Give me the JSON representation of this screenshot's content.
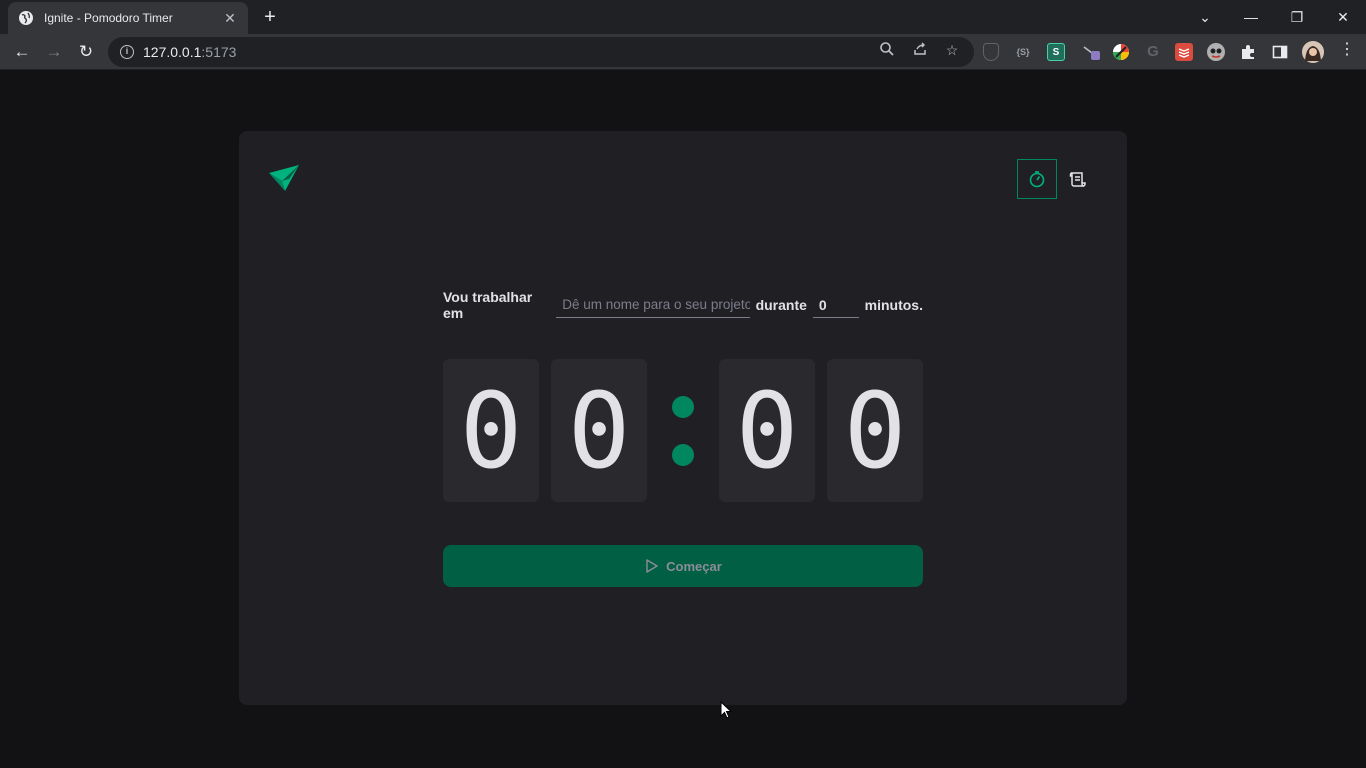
{
  "browser": {
    "tab_title": "Ignite - Pomodoro Timer",
    "url_host": "127.0.0.1",
    "url_port": ":5173",
    "extensions": [
      {
        "name": "shield-extension-icon",
        "label": "",
        "color": "#5f6368"
      },
      {
        "name": "s-bracket-extension-icon",
        "label": "{S}",
        "color": "#35363a"
      },
      {
        "name": "s-extension-icon",
        "label": "S",
        "color": "#0f9d58"
      },
      {
        "name": "arrow-extension-icon",
        "label": "",
        "color": "#8e7cc3"
      },
      {
        "name": "color-wheel-extension-icon",
        "label": "",
        "color": "#34a853"
      },
      {
        "name": "g-extension-icon",
        "label": "",
        "color": "#5f6368"
      },
      {
        "name": "todoist-extension-icon",
        "label": "",
        "color": "#db4c3f"
      },
      {
        "name": "mask-extension-icon",
        "label": "",
        "color": "#9e9e9e"
      }
    ]
  },
  "app": {
    "accent": "#00875f",
    "form": {
      "label_before": "Vou trabalhar em",
      "task_placeholder": "Dê um nome para o seu projeto",
      "label_middle": "durante",
      "minutes_value": "0",
      "label_after": "minutos."
    },
    "countdown": {
      "min_tens": "0",
      "min_ones": "0",
      "sec_tens": "0",
      "sec_ones": "0"
    },
    "start_label": "Começar"
  }
}
